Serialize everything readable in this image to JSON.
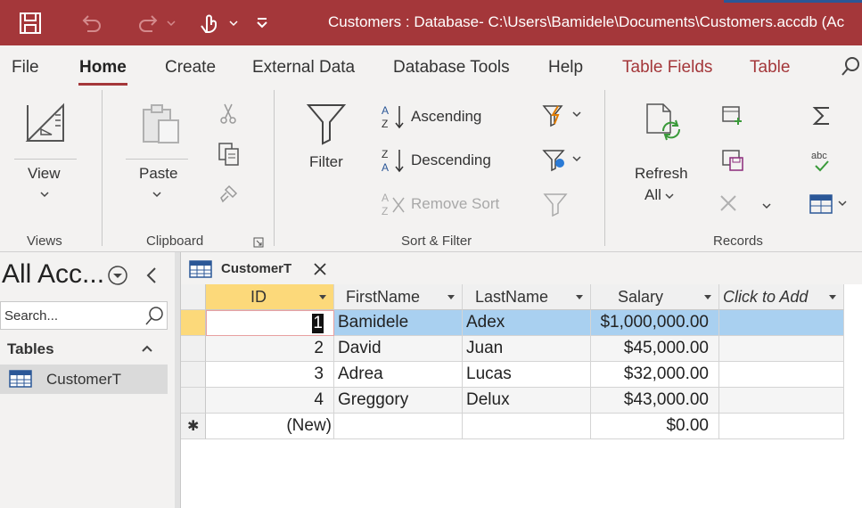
{
  "window": {
    "title": "Customers : Database- C:\\Users\\Bamidele\\Documents\\Customers.accdb (Ac"
  },
  "ribbon_tabs": {
    "file": "File",
    "home": "Home",
    "create": "Create",
    "external_data": "External Data",
    "database_tools": "Database Tools",
    "help": "Help",
    "table_fields": "Table Fields",
    "table": "Table"
  },
  "ribbon": {
    "views": {
      "view": "View",
      "group": "Views"
    },
    "clipboard": {
      "paste": "Paste",
      "group": "Clipboard"
    },
    "sort_filter": {
      "filter": "Filter",
      "ascending": "Ascending",
      "descending": "Descending",
      "remove_sort": "Remove Sort",
      "group": "Sort & Filter"
    },
    "records": {
      "refresh": "Refresh",
      "refresh_all": "All",
      "group": "Records"
    }
  },
  "nav_pane": {
    "title": "All Acc...",
    "search_placeholder": "Search...",
    "section": "Tables",
    "items": [
      {
        "label": "CustomerT"
      }
    ]
  },
  "document_tab": {
    "label": "CustomerT"
  },
  "datasheet": {
    "columns": [
      "ID",
      "FirstName",
      "LastName",
      "Salary",
      "Click to Add"
    ],
    "rows": [
      {
        "id": "1",
        "first": "Bamidele",
        "last": "Adex",
        "salary": "$1,000,000.00"
      },
      {
        "id": "2",
        "first": "David",
        "last": "Juan",
        "salary": "$45,000.00"
      },
      {
        "id": "3",
        "first": "Adrea",
        "last": "Lucas",
        "salary": "$32,000.00"
      },
      {
        "id": "4",
        "first": "Greggory",
        "last": "Delux",
        "salary": "$43,000.00"
      }
    ],
    "new_row": {
      "id": "(New)",
      "salary": "$0.00"
    }
  },
  "colors": {
    "title_bar": "#a4373a",
    "context_tab": "#a4373a",
    "selected_header": "#fcd97a",
    "selected_row": "#a9d0f0"
  }
}
